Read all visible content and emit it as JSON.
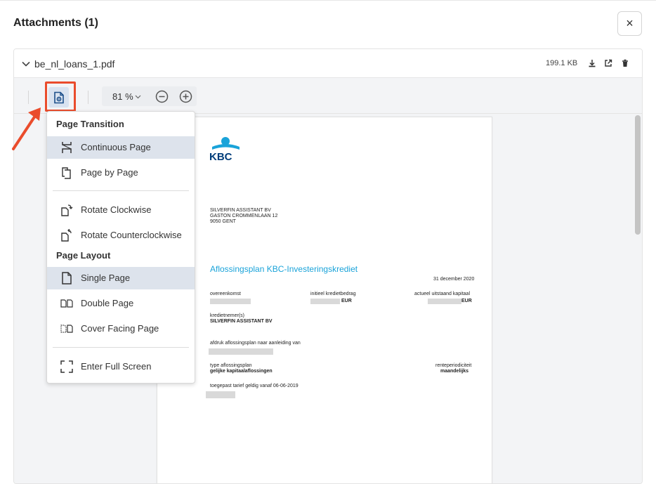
{
  "modal": {
    "title": "Attachments (1)",
    "close_icon": "×"
  },
  "file": {
    "name": "be_nl_loans_1.pdf",
    "size": "199.1 KB"
  },
  "toolbar": {
    "zoom": "81 %"
  },
  "menu": {
    "page_transition_heading": "Page Transition",
    "continuous_page": "Continuous Page",
    "page_by_page": "Page by Page",
    "rotate_clockwise": "Rotate Clockwise",
    "rotate_counterclockwise": "Rotate Counterclockwise",
    "page_layout_heading": "Page Layout",
    "single_page": "Single Page",
    "double_page": "Double Page",
    "cover_facing_page": "Cover Facing Page",
    "enter_full_screen": "Enter Full Screen"
  },
  "document": {
    "logo_text": "KBC",
    "address_line1": "SILVERFIN ASSISTANT BV",
    "address_line2": "GASTON CROMMENLAAN 12",
    "address_line3": "9050 GENT",
    "heading": "Aflossingsplan KBC-Investeringskrediet",
    "date": "31 december 2020",
    "label_overeenkomst": "overeenkomst",
    "label_initieel": "initieel kredietbedrag",
    "currency_1": "EUR",
    "label_actueel": "actueel uitstaand kapitaal",
    "currency_2": "EUR",
    "label_kredietnemer": "kredietnemer(s)",
    "kredietnemer": "SILVERFIN ASSISTANT BV",
    "label_afdruk": "afdruk aflossingsplan naar aanleiding van",
    "label_type": "type aflossingsplan",
    "type_value": "gelijke kapitaalaflossingen",
    "label_rente": "renteperiodiciteit",
    "rente_value": "maandelijks",
    "label_tarief": "toegepast tarief geldig vanaf 06-06-2019"
  },
  "colors": {
    "accent_blue": "#1aa3d9",
    "kbc_navy": "#003d7a",
    "highlight_red": "#ea4c2c",
    "active_bg": "#dde3ec"
  }
}
